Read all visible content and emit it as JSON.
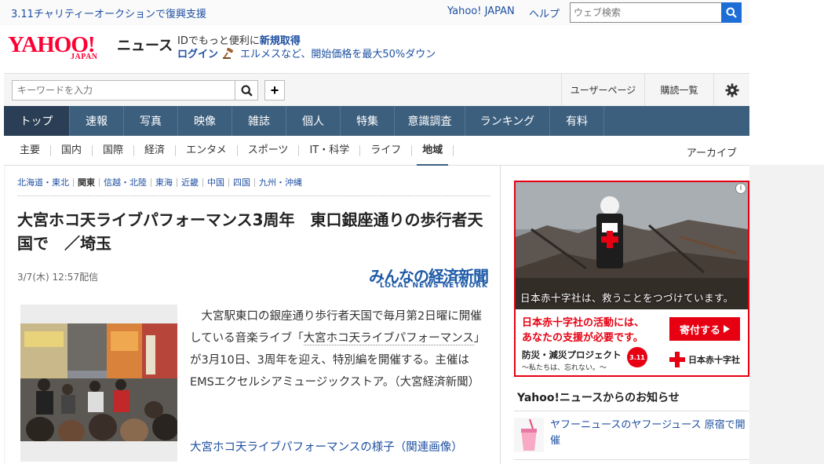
{
  "topbar": {
    "charity_link": "3.11チャリティーオークションで復興支援",
    "yahoo_japan": "Yahoo! JAPAN",
    "help": "ヘルプ",
    "web_search_placeholder": "ウェブ検索"
  },
  "header": {
    "logo_main": "YAHOO!",
    "logo_sub": "JAPAN",
    "logo_news": "ニュース",
    "promo_text": "IDでもっと便利に",
    "promo_register": "新規取得",
    "login": "ログイン",
    "auction_promo": "エルメスなど、開始価格を最大50%ダウン"
  },
  "searchbar": {
    "placeholder": "キーワードを入力",
    "user_page": "ユーザーページ",
    "subscriptions": "購読一覧"
  },
  "main_nav": {
    "items": [
      "トップ",
      "速報",
      "写真",
      "映像",
      "雑誌",
      "個人",
      "特集",
      "意識調査",
      "ランキング",
      "有料"
    ],
    "active": "トップ"
  },
  "sub_nav": {
    "items": [
      "主要",
      "国内",
      "国際",
      "経済",
      "エンタメ",
      "スポーツ",
      "IT・科学",
      "ライフ",
      "地域"
    ],
    "active": "地域",
    "archive": "アーカイブ"
  },
  "article": {
    "regions": [
      "北海道・東北",
      "関東",
      "信越・北陸",
      "東海",
      "近畿",
      "中国",
      "四国",
      "九州・沖縄"
    ],
    "current_region": "関東",
    "headline": "大宮ホコ天ライブパフォーマンス3周年　東口銀座通りの歩行者天国で　／埼玉",
    "date": "3/7(木) 12:57配信",
    "source_name": "みんなの経済新聞",
    "source_sub": "LOCAL NEWS NETWORK",
    "lead_before": "大宮駅東口の銀座通り歩行者天国で毎月第2日曜に開催している音楽ライブ「",
    "lead_link": "大宮ホコ天ライブパフォーマンス",
    "lead_after": "」が3月10日、3周年を迎え、特別編を開催する。主催はEMSエクセルシアミュージックストア。（大宮経済新聞）",
    "related_link": "大宮ホコ天ライブパフォーマンスの様子（関連画像）"
  },
  "ad": {
    "caption": "日本赤十字社は、救うことをつづけています。",
    "message_line1": "日本赤十字社の活動には、",
    "message_line2": "あなたの支援が必要です。",
    "donate": "寄付する",
    "project": "防災・減災プロジェクト",
    "project_sub": "～私たちは、忘れない。～",
    "badge_311": "3.11",
    "org": "日本赤十字社"
  },
  "notices": {
    "title": "Yahoo!ニュースからのお知らせ",
    "item": "ヤフーニュースのヤフージュース 原宿で開催"
  },
  "colors": {
    "brand_red": "#ff0033",
    "link_blue": "#1e50a2",
    "nav_bg": "#3d5f7e",
    "nav_active": "#2a3f55",
    "search_blue": "#1c6ed6",
    "red_cross": "#e60012"
  }
}
